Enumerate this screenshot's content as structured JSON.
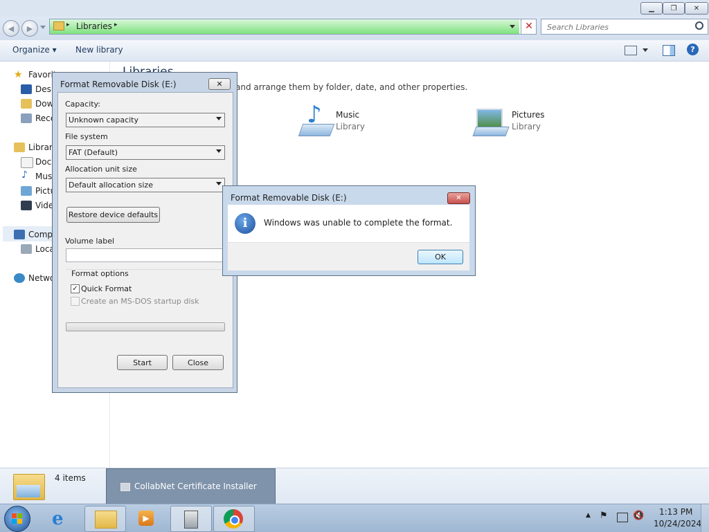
{
  "window": {
    "controls": [
      "minimize",
      "maximize",
      "close"
    ]
  },
  "address": {
    "path_root_arrow": "▸",
    "location": "Libraries",
    "path_arrow": "▸"
  },
  "search": {
    "placeholder": "Search Libraries"
  },
  "toolbar": {
    "organize": "Organize ▾",
    "new_library": "New library"
  },
  "nav": {
    "favorites": "Favorit",
    "desktop": "Desk",
    "downloads": "Dow",
    "recent": "Rece",
    "libraries": "Librari",
    "documents": "Docu",
    "music": "Mus",
    "pictures": "Pictu",
    "videos": "Vide",
    "computer": "Comp",
    "local_disk": "Loca",
    "network": "Netwo"
  },
  "content": {
    "heading": "Libraries",
    "subtitle": "and arrange them by folder, date, and other properties.",
    "libraries": [
      {
        "name": "Music",
        "type": "Library"
      },
      {
        "name": "Pictures",
        "type": "Library"
      }
    ]
  },
  "details": {
    "count": "4 items"
  },
  "format_dialog": {
    "title": "Format Removable Disk (E:)",
    "close_glyph": "✕",
    "capacity_label": "Capacity:",
    "capacity_value": "Unknown capacity",
    "filesystem_label": "File system",
    "filesystem_value": "FAT (Default)",
    "allocation_label": "Allocation unit size",
    "allocation_value": "Default allocation size",
    "restore_button": "Restore device defaults",
    "volume_label": "Volume label",
    "volume_value": "",
    "options_label": "Format options",
    "quick_format": "Quick Format",
    "quick_format_checked": true,
    "msdos_disk": "Create an MS-DOS startup disk",
    "msdos_checked": false,
    "progress": 0,
    "start_button": "Start",
    "close_button": "Close"
  },
  "error_dialog": {
    "title": "Format Removable Disk (E:)",
    "close_glyph": "✕",
    "message": "Windows was unable to complete the format.",
    "ok_button": "OK"
  },
  "taskbar_preview": {
    "label": "CollabNet Certificate Installer"
  },
  "clock": {
    "time": "1:13 PM",
    "date": "10/24/2024"
  },
  "colors": {
    "accent": "#1e395b",
    "address_progress": "#7ee27e",
    "close_red": "#c75050"
  }
}
